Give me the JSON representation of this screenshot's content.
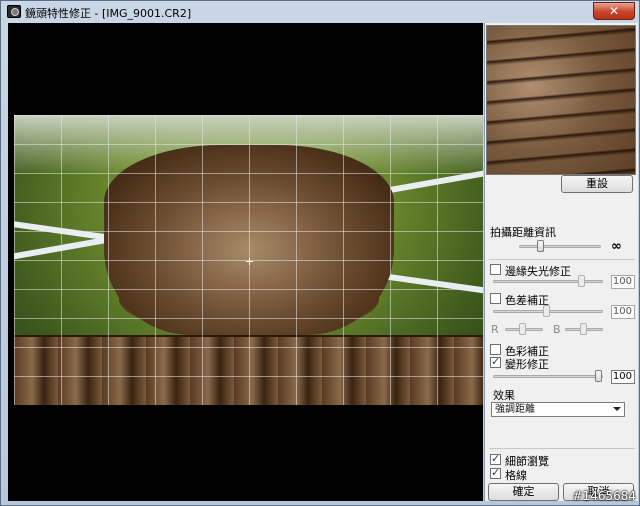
{
  "window": {
    "title": "鏡頭特性修正 - [IMG_9001.CR2]",
    "close_glyph": "✕"
  },
  "panel": {
    "reset_label": "重設",
    "distance_label": "拍攝距離資訊",
    "infinity_glyph": "∞",
    "peripheral": {
      "label": "邊緣失光修正",
      "checked": false,
      "value": "100"
    },
    "chromatic": {
      "label": "色差補正",
      "checked": false,
      "value": "100",
      "r_label": "R",
      "b_label": "B"
    },
    "color_blur": {
      "label": "色彩補正",
      "checked": false
    },
    "distortion": {
      "label": "變形修正",
      "checked": true,
      "value": "100"
    },
    "effect": {
      "label": "效果",
      "selected": "強調距離"
    },
    "detail_view": {
      "label": "細節瀏覽",
      "checked": true
    },
    "grid_lines": {
      "label": "格線",
      "checked": true
    },
    "ok_label": "確定",
    "cancel_label": "取消"
  },
  "watermark": "#1465684"
}
